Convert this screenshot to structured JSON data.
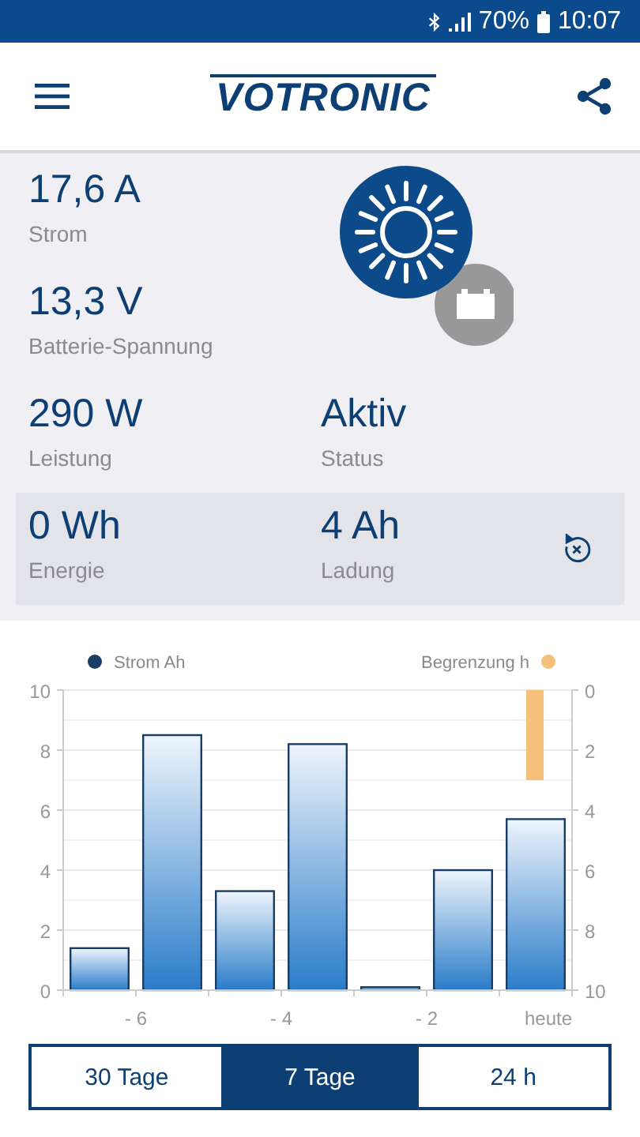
{
  "status_bar": {
    "battery_percent": "70%",
    "time": "10:07"
  },
  "header": {
    "logo": "VOTRONIC"
  },
  "metrics": [
    {
      "value": "17,6 A",
      "label": "Strom"
    },
    {
      "value": "13,3 V",
      "label": "Batterie-Spannung"
    },
    {
      "value": "290 W",
      "label": "Leistung"
    },
    {
      "value": "Aktiv",
      "label": "Status"
    }
  ],
  "counters": [
    {
      "value": "0 Wh",
      "label": "Energie"
    },
    {
      "value": "4 Ah",
      "label": "Ladung"
    }
  ],
  "chart": {
    "chart_data": {
      "type": "bar",
      "x": [
        -6.5,
        -5.5,
        -4.5,
        -3.5,
        -2.5,
        -1.5,
        -0.5
      ],
      "xlim": [
        -7,
        0
      ],
      "series": [
        {
          "name": "Strom Ah",
          "color": "#1a3d66",
          "values": [
            1.4,
            8.5,
            3.3,
            8.2,
            0.1,
            4.0,
            5.7
          ]
        },
        {
          "name": "Begrenzung h",
          "color": "#f5c07a",
          "axis": "y2",
          "values": [
            null,
            null,
            null,
            null,
            null,
            null,
            3
          ]
        }
      ],
      "ylim": [
        0,
        10
      ],
      "yticks": [
        0,
        2,
        4,
        6,
        8,
        10
      ],
      "y2ticks": [
        0,
        2,
        4,
        6,
        8,
        10
      ],
      "y2lim": [
        10,
        0
      ],
      "grid": true,
      "xticks": [
        {
          "value": -6,
          "label": "- 6"
        },
        {
          "value": -4,
          "label": "- 4"
        },
        {
          "value": -2,
          "label": "- 2"
        },
        {
          "value": 0,
          "label": "heute"
        }
      ]
    }
  },
  "range_tabs": [
    {
      "label": "30 Tage",
      "selected": false
    },
    {
      "label": "7 Tage",
      "selected": true
    },
    {
      "label": "24 h",
      "selected": false
    }
  ]
}
